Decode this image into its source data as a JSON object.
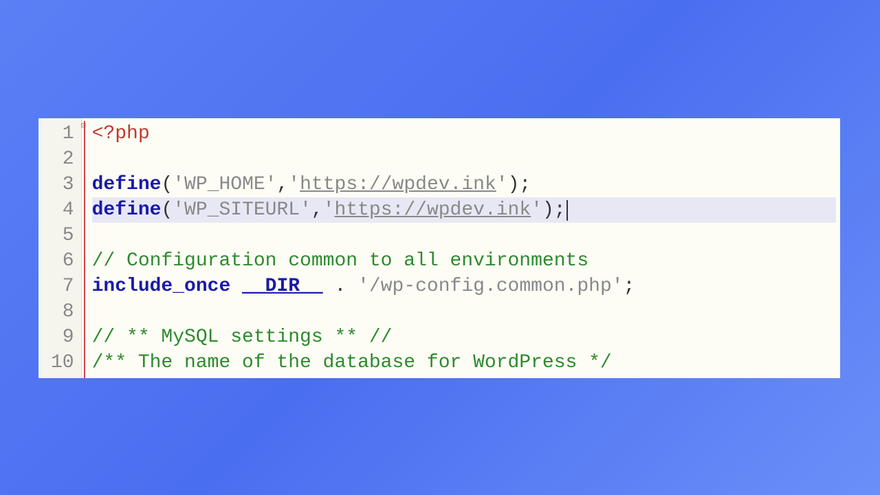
{
  "editor": {
    "language": "php",
    "lines": [
      {
        "num": "1",
        "tokens": [
          {
            "cls": "tok-tag",
            "text": "<?php"
          }
        ]
      },
      {
        "num": "2",
        "tokens": []
      },
      {
        "num": "3",
        "tokens": [
          {
            "cls": "tok-key",
            "text": "define"
          },
          {
            "cls": "tok-def",
            "text": "("
          },
          {
            "cls": "tok-str",
            "text": "'WP_HOME'"
          },
          {
            "cls": "tok-def",
            "text": ","
          },
          {
            "cls": "tok-str",
            "text": "'"
          },
          {
            "cls": "tok-url",
            "text": "https://wpdev.ink"
          },
          {
            "cls": "tok-str",
            "text": "'"
          },
          {
            "cls": "tok-def",
            "text": ");"
          }
        ]
      },
      {
        "num": "4",
        "current": true,
        "tokens": [
          {
            "cls": "tok-key",
            "text": "define"
          },
          {
            "cls": "tok-def",
            "text": "("
          },
          {
            "cls": "tok-str",
            "text": "'WP_SITEURL'"
          },
          {
            "cls": "tok-def",
            "text": ","
          },
          {
            "cls": "tok-str",
            "text": "'"
          },
          {
            "cls": "tok-url",
            "text": "https://wpdev.ink"
          },
          {
            "cls": "tok-str",
            "text": "'"
          },
          {
            "cls": "tok-def",
            "text": ");"
          }
        ],
        "cursorAfter": true
      },
      {
        "num": "5",
        "tokens": []
      },
      {
        "num": "6",
        "tokens": [
          {
            "cls": "tok-com",
            "text": "// Configuration common to all environments"
          }
        ]
      },
      {
        "num": "7",
        "tokens": [
          {
            "cls": "tok-key",
            "text": "include_once"
          },
          {
            "cls": "tok-def",
            "text": " "
          },
          {
            "cls": "tok-const",
            "text": "__DIR__"
          },
          {
            "cls": "tok-def",
            "text": " . "
          },
          {
            "cls": "tok-str",
            "text": "'/wp-config.common.php'"
          },
          {
            "cls": "tok-def",
            "text": ";"
          }
        ]
      },
      {
        "num": "8",
        "tokens": []
      },
      {
        "num": "9",
        "tokens": [
          {
            "cls": "tok-com",
            "text": "// ** MySQL settings ** //"
          }
        ]
      },
      {
        "num": "10",
        "tokens": [
          {
            "cls": "tok-com",
            "text": "/** The name of the database for WordPress */"
          }
        ]
      }
    ],
    "foldMarker": "⊟"
  }
}
